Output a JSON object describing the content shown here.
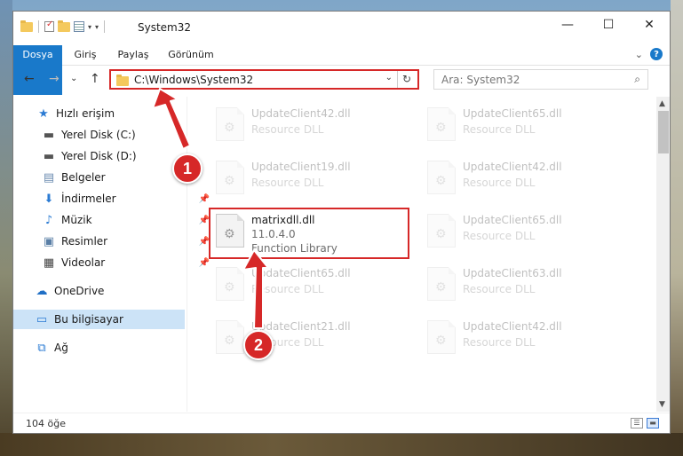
{
  "window": {
    "title": "System32",
    "controls": {
      "minimize": "—",
      "maximize": "☐",
      "close": "✕"
    }
  },
  "ribbon": {
    "tabs": [
      "Dosya",
      "Giriş",
      "Paylaş",
      "Görünüm"
    ],
    "expand": "⌄",
    "help": "?"
  },
  "nav": {
    "back": "←",
    "forward": "→",
    "recent": "⌄",
    "up": "↑",
    "address": "C:\\Windows\\System32",
    "address_dropdown": "⌄",
    "refresh": "↻",
    "search_placeholder": "Ara: System32",
    "search_icon": "⌕"
  },
  "sidebar": {
    "items": [
      {
        "label": "Hızlı erişim",
        "icon": "star-icon"
      },
      {
        "label": "Yerel Disk (C:)",
        "icon": "drive-icon"
      },
      {
        "label": "Yerel Disk (D:)",
        "icon": "drive-icon"
      },
      {
        "label": "Belgeler",
        "icon": "documents-icon"
      },
      {
        "label": "İndirmeler",
        "icon": "download-icon"
      },
      {
        "label": "Müzik",
        "icon": "music-icon"
      },
      {
        "label": "Resimler",
        "icon": "pictures-icon"
      },
      {
        "label": "Videolar",
        "icon": "videos-icon"
      },
      {
        "label": "OneDrive",
        "icon": "cloud-icon"
      },
      {
        "label": "Bu bilgisayar",
        "icon": "computer-icon"
      },
      {
        "label": "Ağ",
        "icon": "network-icon"
      }
    ],
    "pin": "📌"
  },
  "files": [
    {
      "name": "UpdateClient42.dll",
      "type": "Resource DLL"
    },
    {
      "name": "UpdateClient65.dll",
      "type": "Resource DLL"
    },
    {
      "name": "UpdateClient19.dll",
      "type": "Resource DLL"
    },
    {
      "name": "UpdateClient42.dll",
      "type": "Resource DLL"
    },
    {
      "name": "matrixdll.dll",
      "version": "11.0.4.0",
      "type": "Function Library"
    },
    {
      "name": "UpdateClient65.dll",
      "type": "Resource DLL"
    },
    {
      "name": "UpdateClient65.dll",
      "type": "Resource DLL"
    },
    {
      "name": "UpdateClient63.dll",
      "type": "Resource DLL"
    },
    {
      "name": "UpdateClient21.dll",
      "type": "Resource DLL"
    },
    {
      "name": "UpdateClient42.dll",
      "type": "Resource DLL"
    }
  ],
  "status": {
    "count": "104 öğe"
  },
  "annotations": {
    "step1": "1",
    "step2": "2",
    "color": "#d62828"
  }
}
